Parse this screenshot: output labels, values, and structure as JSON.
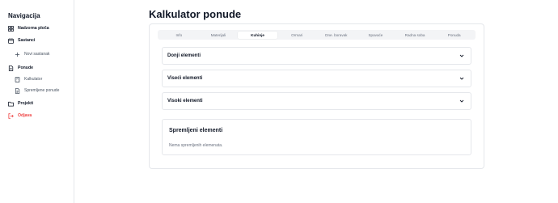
{
  "sidebar": {
    "title": "Navigacija",
    "items": [
      {
        "label": "Nadzorna ploča",
        "icon": "dashboard-icon"
      },
      {
        "label": "Sastanci",
        "icon": "calendar-icon"
      },
      {
        "label": "Novi sastanak",
        "icon": "plus-icon"
      },
      {
        "label": "Ponude",
        "icon": "file-icon"
      },
      {
        "label": "Kalkulator",
        "icon": "calculator-icon"
      },
      {
        "label": "Spremljene ponude",
        "icon": "document-icon"
      },
      {
        "label": "Projekti",
        "icon": "folder-icon"
      },
      {
        "label": "Odjava",
        "icon": "logout-icon"
      }
    ]
  },
  "main": {
    "title": "Kalkulator ponude",
    "tabs": [
      "Info",
      "Materijali",
      "Kuhinje",
      "Ormari",
      "Dne. boravak",
      "Spavaće",
      "Radna soba",
      "Ponuda"
    ],
    "active_tab": "Kuhinje",
    "accordions": [
      "Donji elementi",
      "Viseći elementi",
      "Visoki elementi"
    ],
    "saved": {
      "title": "Spremljeni elementi",
      "empty_text": "Nema spremljenih elemenata."
    }
  },
  "colors": {
    "logout": "#ef4444",
    "border": "#e5e7eb",
    "tabs_bg": "#f3f4f6",
    "text": "#111827",
    "muted": "#6b7280"
  }
}
